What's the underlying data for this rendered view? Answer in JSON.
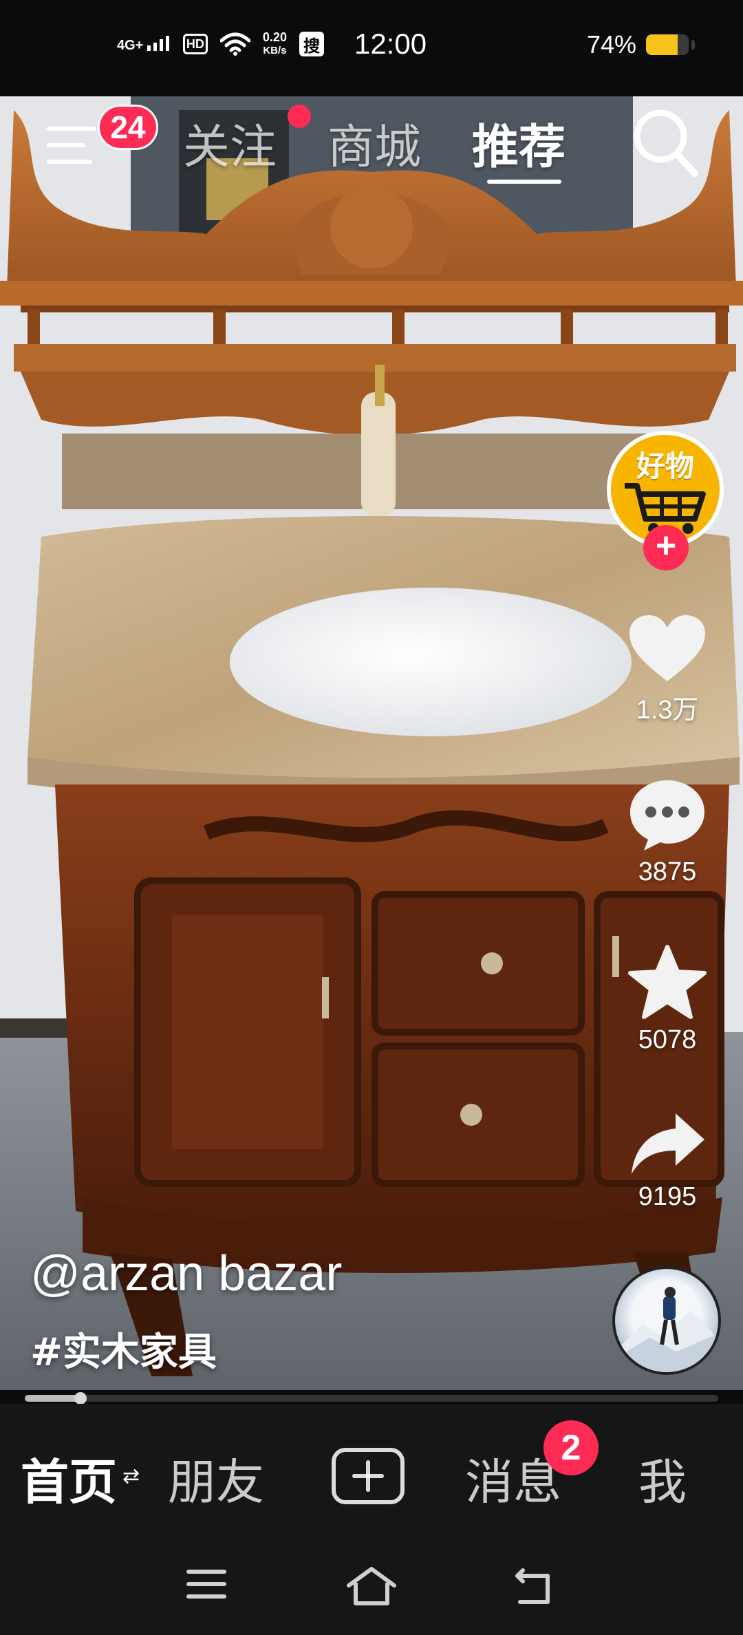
{
  "status_bar": {
    "network": "4G+",
    "hd_label": "HD",
    "speed_value": "0.20",
    "speed_unit": "KB/s",
    "search_label": "搜",
    "time": "12:00",
    "battery_text": "74%",
    "battery_level": 0.74,
    "battery_color": "#f6c21c"
  },
  "top_nav": {
    "menu_badge": "24",
    "tabs": [
      {
        "label": "关注",
        "has_dot": true
      },
      {
        "label": "商城",
        "has_dot": false
      },
      {
        "label": "推荐",
        "active": true
      }
    ],
    "search_icon": "search-icon",
    "accent_color": "#fe2c55"
  },
  "right_rail": {
    "shop_label": "好物",
    "follow_icon": "plus-icon",
    "likes": "1.3万",
    "comments": "3875",
    "favorites": "5078",
    "shares": "9195"
  },
  "caption": {
    "author": "@arzan bazar",
    "hashtag": "#实木家具"
  },
  "progress": {
    "fraction": 0.08
  },
  "bottom_nav": {
    "items": [
      {
        "label": "首页",
        "active": true
      },
      {
        "label": "朋友"
      },
      {
        "label": "",
        "icon": "add-icon"
      },
      {
        "label": "消息"
      },
      {
        "label": "我"
      }
    ],
    "swap_icon": "⇄",
    "message_badge": "2"
  },
  "system_nav": {
    "icons": [
      "menu-icon",
      "home-icon",
      "back-icon"
    ]
  }
}
